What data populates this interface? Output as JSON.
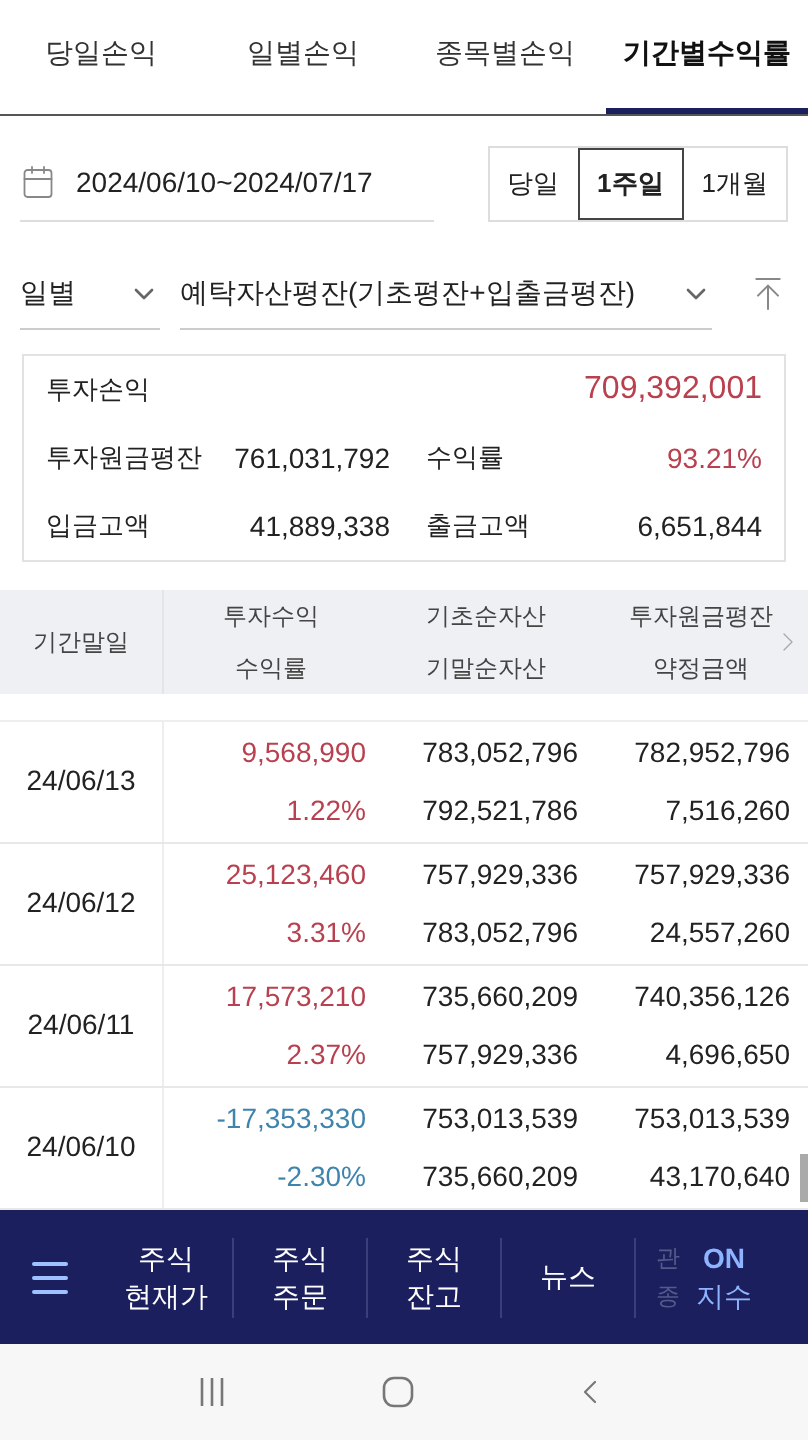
{
  "tabs": [
    {
      "label": "당일손익",
      "selected": false
    },
    {
      "label": "일별손익",
      "selected": false
    },
    {
      "label": "종목별손익",
      "selected": false
    },
    {
      "label": "기간별수익률",
      "selected": true
    }
  ],
  "period": {
    "range": "2024/06/10~2024/07/17",
    "options": [
      {
        "label": "당일",
        "selected": false
      },
      {
        "label": "1주일",
        "selected": true
      },
      {
        "label": "1개월",
        "selected": false
      }
    ]
  },
  "filters": {
    "unit": "일별",
    "basis": "예탁자산평잔(기초평잔+입출금평잔)"
  },
  "summary": {
    "profit_label": "투자손익",
    "profit": "709,392,001",
    "principal_label": "투자원금평잔",
    "principal": "761,031,792",
    "rate_label": "수익률",
    "rate": "93.21%",
    "deposit_label": "입금고액",
    "deposit": "41,889,338",
    "withdraw_label": "출금고액",
    "withdraw": "6,651,844"
  },
  "table": {
    "columns": [
      [
        "기간말일"
      ],
      [
        "투자수익",
        "수익률"
      ],
      [
        "기초순자산",
        "기말순자산"
      ],
      [
        "투자원금평잔",
        "약정금액"
      ]
    ],
    "rows": [
      {
        "date": "24/06/13",
        "color": "#b8404f",
        "profit": "9,568,990",
        "rate": "1.22%",
        "begin": "783,052,796",
        "end": "792,521,786",
        "principal": "782,952,796",
        "contract": "7,516,260"
      },
      {
        "date": "24/06/12",
        "color": "#b8404f",
        "profit": "25,123,460",
        "rate": "3.31%",
        "begin": "757,929,336",
        "end": "783,052,796",
        "principal": "757,929,336",
        "contract": "24,557,260"
      },
      {
        "date": "24/06/11",
        "color": "#b8404f",
        "profit": "17,573,210",
        "rate": "2.37%",
        "begin": "735,660,209",
        "end": "757,929,336",
        "principal": "740,356,126",
        "contract": "4,696,650"
      },
      {
        "date": "24/06/10",
        "color": "#3f84ad",
        "profit": "-17,353,330",
        "rate": "-2.30%",
        "begin": "753,013,539",
        "end": "735,660,209",
        "principal": "753,013,539",
        "contract": "43,170,640"
      }
    ]
  },
  "bottom_nav": {
    "items": [
      [
        "주식",
        "현재가"
      ],
      [
        "주식",
        "주문"
      ],
      [
        "주식",
        "잔고"
      ],
      [
        "뉴스"
      ]
    ],
    "faded": [
      "관",
      "종"
    ],
    "index_toggle": [
      "ON",
      "지수"
    ]
  }
}
